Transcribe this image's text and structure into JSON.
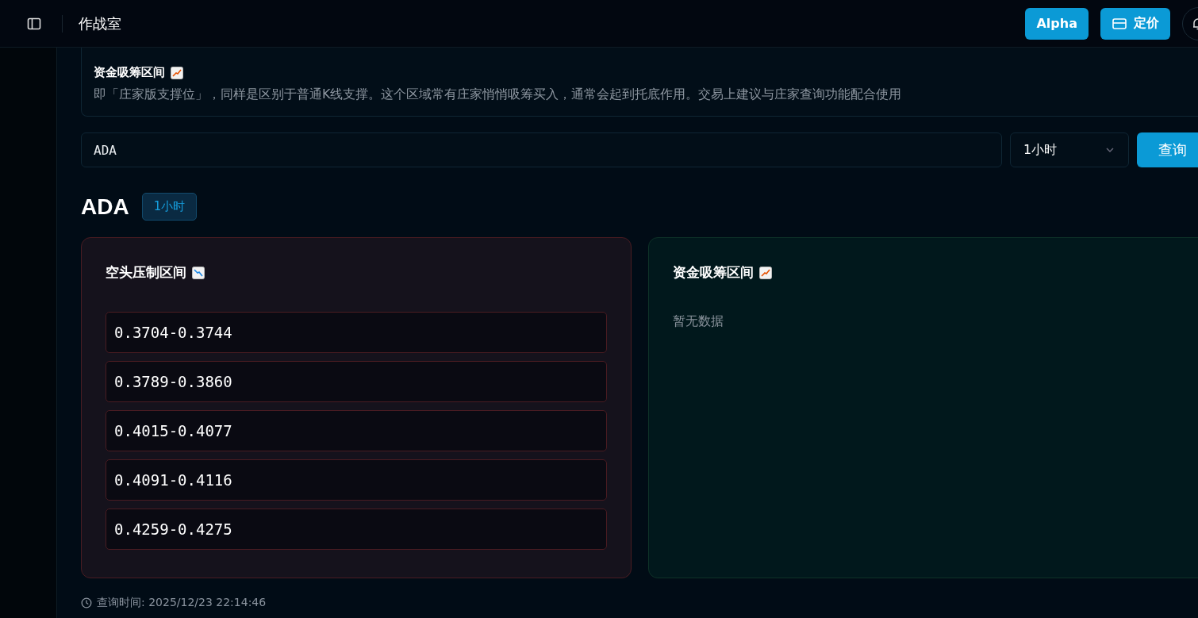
{
  "header": {
    "title": "作战室",
    "buttons": [
      {
        "kind": "text",
        "label": "Alpha"
      },
      {
        "kind": "card",
        "label": "定价"
      },
      {
        "kind": "bell"
      }
    ]
  },
  "info": {
    "heading": "资金吸筹区间",
    "text": "即「庄家版支撑位」，同样是区别于普通K线支撑。这个区域常有庄家悄悄吸筹买入，通常会起到托底作用。交易上建议与庄家查询功能配合使用"
  },
  "query": {
    "symbol": "ADA",
    "interval": "1小时",
    "button": "查询"
  },
  "result": {
    "symbol": "ADA",
    "interval": "1小时"
  },
  "panels": [
    {
      "kind": "resistance",
      "title": "空头压制区间",
      "ranges": [
        "0.3704-0.3744",
        "0.3789-0.3860",
        "0.4015-0.4077",
        "0.4091-0.4116",
        "0.4259-0.4275"
      ]
    },
    {
      "kind": "support",
      "title": "资金吸筹区间",
      "empty_text": "暂无数据"
    }
  ],
  "query_time": "查询时间: 2025/12/23 22:14:46"
}
